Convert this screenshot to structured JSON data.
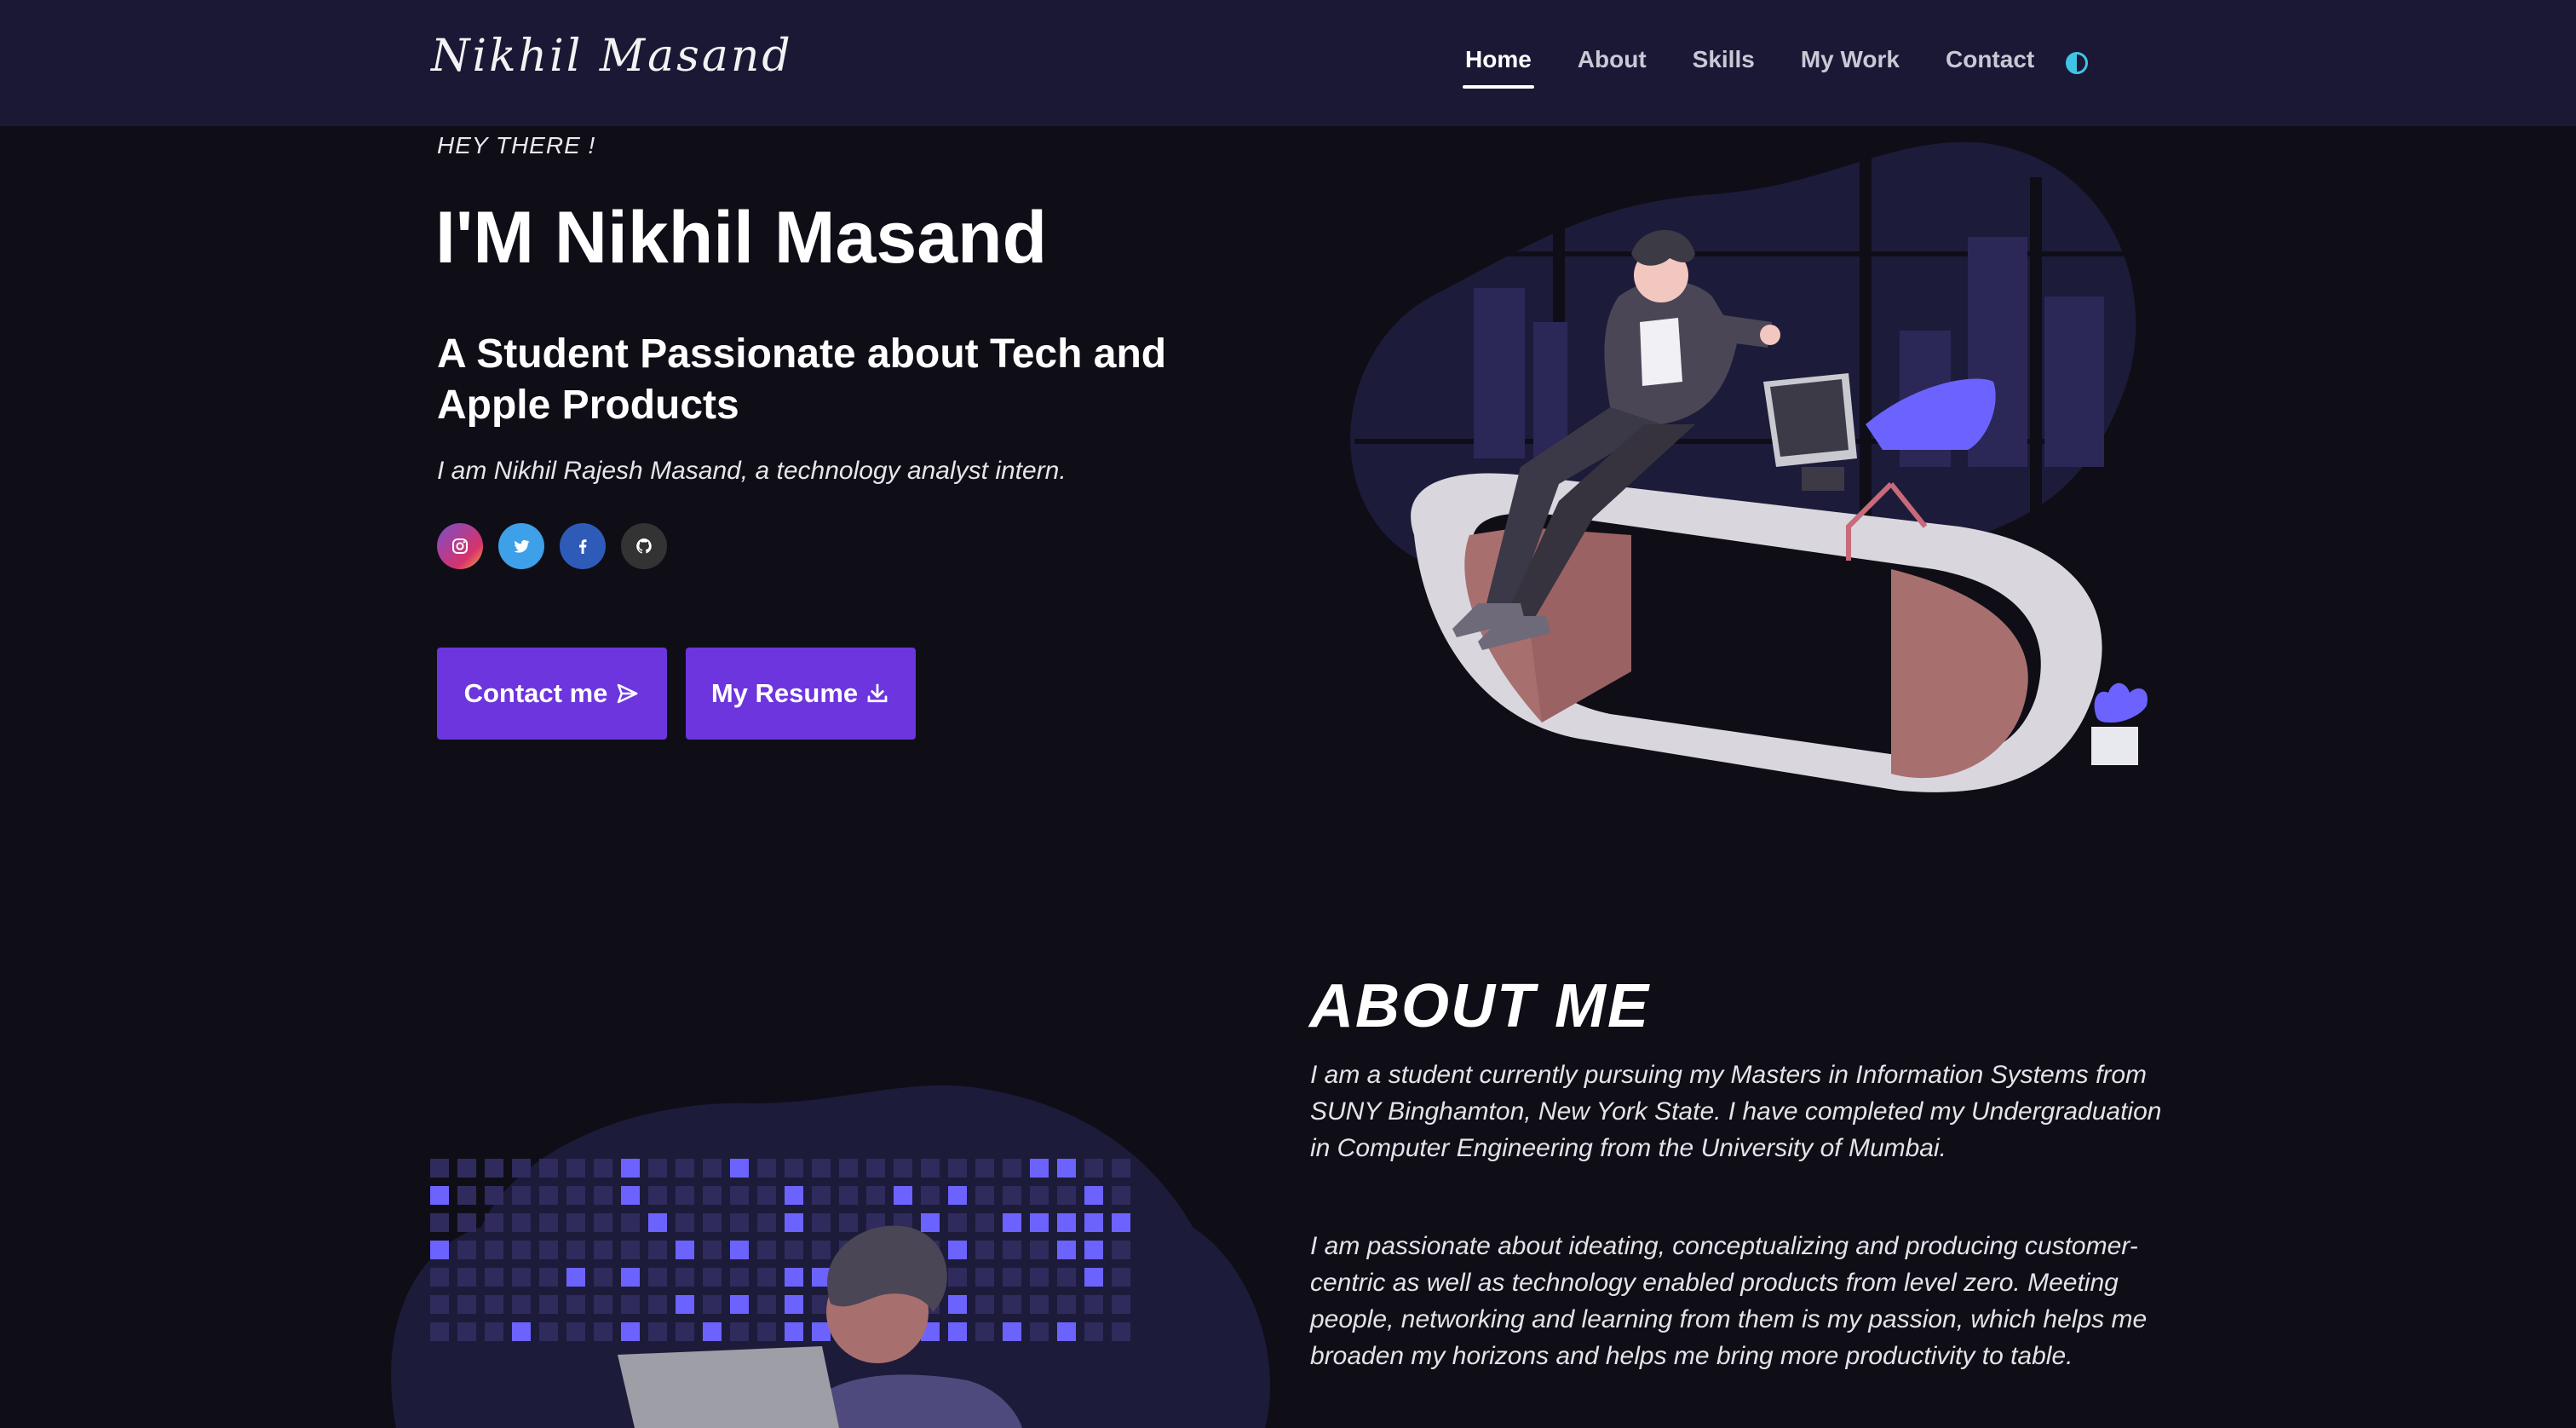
{
  "navbar": {
    "brand": "Nikhil Masand",
    "links": [
      {
        "label": "Home",
        "active": true
      },
      {
        "label": "About",
        "active": false
      },
      {
        "label": "Skills",
        "active": false
      },
      {
        "label": "My Work",
        "active": false
      },
      {
        "label": "Contact",
        "active": false
      }
    ],
    "theme_toggle_icon": "half-moon-icon"
  },
  "hero": {
    "eyebrow": "HEY THERE !",
    "title": "I'M Nikhil Masand",
    "subtitle": "A Student Passionate about Tech and Apple Products",
    "description": "I am Nikhil Rajesh Masand, a technology analyst intern.",
    "socials": [
      {
        "icon": "instagram-icon",
        "color": "#d6336c"
      },
      {
        "icon": "twitter-icon",
        "color": "#3da0e8"
      },
      {
        "icon": "facebook-icon",
        "color": "#2e5bb8"
      },
      {
        "icon": "github-icon",
        "color": "#333333"
      }
    ],
    "buttons": {
      "contact": "Contact me",
      "resume": "My Resume"
    }
  },
  "about": {
    "title": "ABOUT ME",
    "paragraphs": [
      "I am a student currently pursuing my Masters in Information Systems from SUNY Binghamton, New York State. I have completed my Undergraduation in Computer Engineering from the University of Mumbai.",
      "I am passionate about ideating, conceptualizing and producing customer-centric as well as technology enabled products from level zero. Meeting people, networking and learning from them is my passion, which helps me broaden my horizons and helps me bring more productivity to table."
    ]
  },
  "colors": {
    "background": "#0f0e17",
    "navbar": "#1b1836",
    "accent": "#6c35de",
    "illustration_purple": "#6c63ff"
  }
}
